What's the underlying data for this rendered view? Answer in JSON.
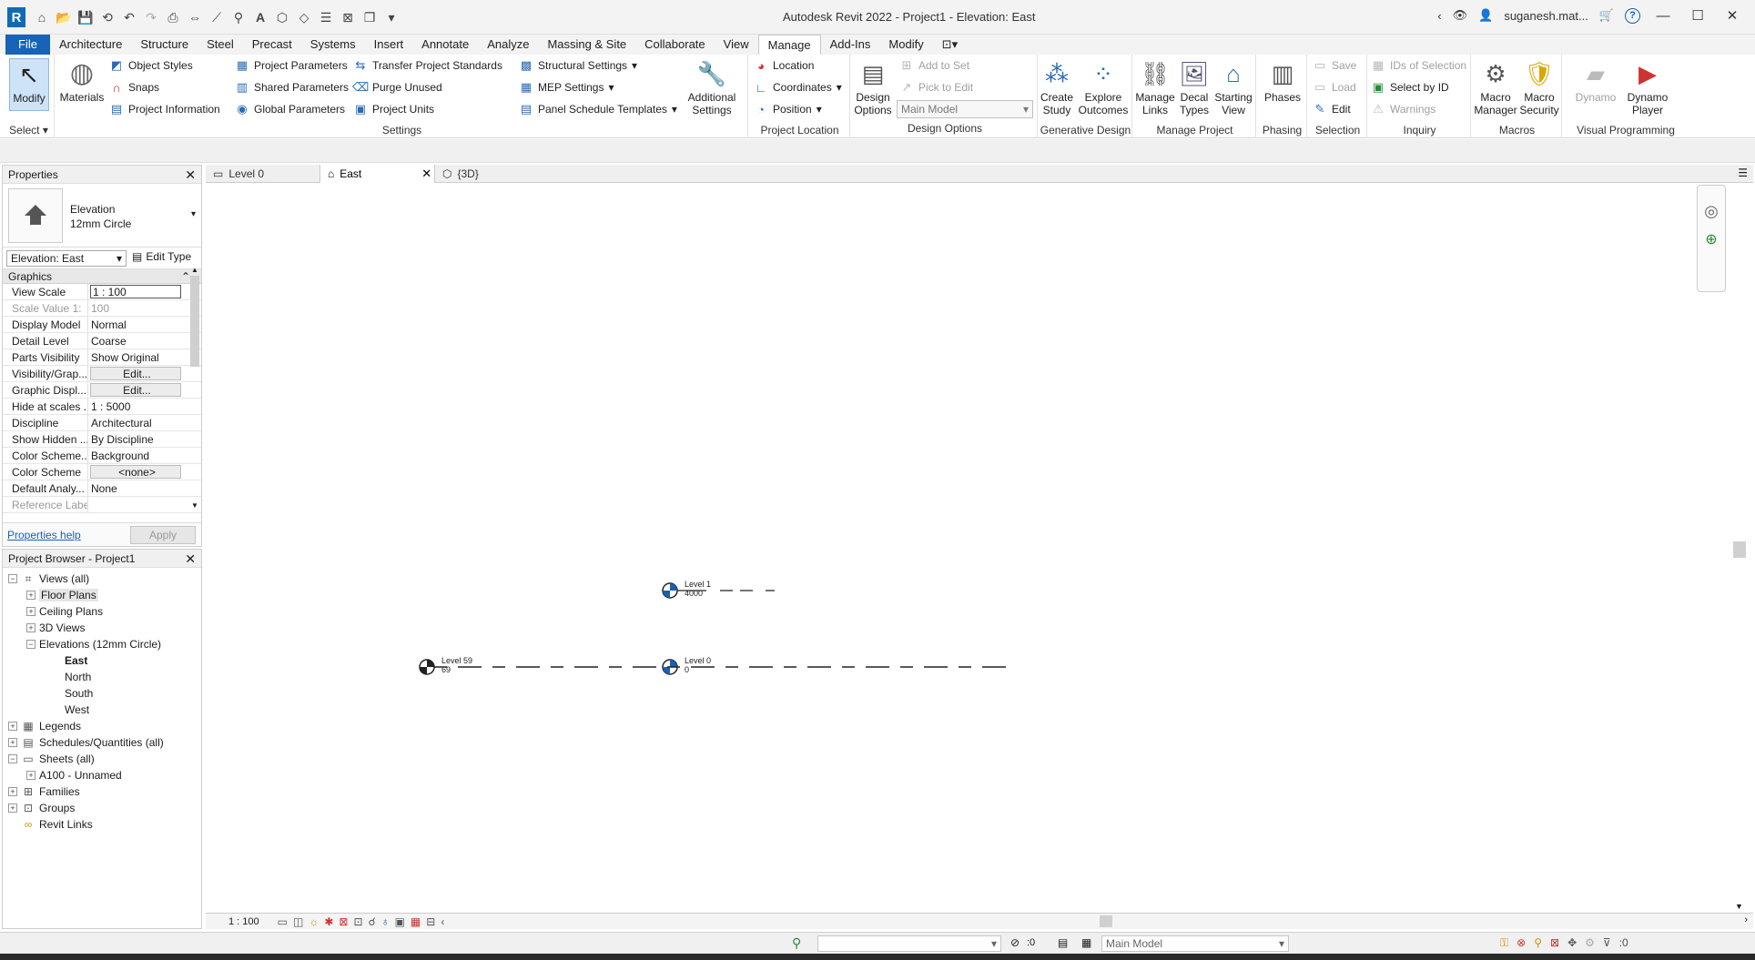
{
  "app": {
    "title": "Autodesk Revit 2022 - Project1 - Elevation: East",
    "user": "suganesh.mat...",
    "help": "?"
  },
  "menu": {
    "tabs": [
      "File",
      "Architecture",
      "Structure",
      "Steel",
      "Precast",
      "Systems",
      "Insert",
      "Annotate",
      "Analyze",
      "Massing & Site",
      "Collaborate",
      "View",
      "Manage",
      "Add-Ins",
      "Modify"
    ],
    "active": "Manage"
  },
  "ribbon": {
    "select": {
      "modify": "Modify",
      "title": "Select"
    },
    "settings": {
      "materials": "Materials",
      "object_styles": "Object  Styles",
      "snaps": "Snaps",
      "project_information": "Project  Information",
      "project_parameters": "Project  Parameters",
      "shared_parameters": "Shared  Parameters",
      "global_parameters": "Global  Parameters",
      "transfer_standards": "Transfer  Project Standards",
      "purge_unused": "Purge  Unused",
      "project_units": "Project  Units",
      "structural_settings": "Structural  Settings",
      "mep_settings": "MEP  Settings",
      "panel_schedule_templates": "Panel Schedule  Templates",
      "additional_settings_1": "Additional",
      "additional_settings_2": "Settings",
      "title": "Settings"
    },
    "project_location": {
      "location": "Location",
      "coordinates": "Coordinates",
      "position": "Position",
      "title": "Project Location"
    },
    "design_options": {
      "btn1": "Design",
      "btn2": "Options",
      "add_to_set": "Add to Set",
      "pick_to_edit": "Pick to Edit",
      "main_model": "Main Model",
      "title": "Design Options"
    },
    "generative_design": {
      "create_1": "Create",
      "create_2": "Study",
      "explore_1": "Explore",
      "explore_2": "Outcomes",
      "title": "Generative Design"
    },
    "manage_project": {
      "links_1": "Manage",
      "links_2": "Links",
      "decal_1": "Decal",
      "decal_2": "Types",
      "start_1": "Starting",
      "start_2": "View",
      "title": "Manage Project"
    },
    "phasing": {
      "phases": "Phases",
      "title": "Phasing"
    },
    "selection": {
      "save": "Save",
      "load": "Load",
      "edit": "Edit",
      "title": "Selection"
    },
    "inquiry": {
      "ids": "IDs of  Selection",
      "select_by_id": "Select  by ID",
      "warnings": "Warnings",
      "title": "Inquiry"
    },
    "macros": {
      "mm_1": "Macro",
      "mm_2": "Manager",
      "ms_1": "Macro",
      "ms_2": "Security",
      "title": "Macros"
    },
    "visual_programming": {
      "dynamo": "Dynamo",
      "player_1": "Dynamo",
      "player_2": "Player",
      "title": "Visual Programming"
    }
  },
  "properties": {
    "header": "Properties",
    "type_family": "Elevation",
    "type_name": "12mm Circle",
    "instance": "Elevation: East",
    "edit_type": "Edit Type",
    "group": "Graphics",
    "rows": [
      {
        "k": "View Scale",
        "v": "1 : 100"
      },
      {
        "k": "Scale Value    1:",
        "v": "100"
      },
      {
        "k": "Display Model",
        "v": "Normal"
      },
      {
        "k": "Detail Level",
        "v": "Coarse"
      },
      {
        "k": "Parts Visibility",
        "v": "Show Original"
      },
      {
        "k": "Visibility/Grap...",
        "v": "Edit..."
      },
      {
        "k": "Graphic Displ...",
        "v": "Edit..."
      },
      {
        "k": "Hide at scales ...",
        "v": "1 : 5000"
      },
      {
        "k": "Discipline",
        "v": "Architectural"
      },
      {
        "k": "Show Hidden ...",
        "v": "By Discipline"
      },
      {
        "k": "Color Scheme...",
        "v": "Background"
      },
      {
        "k": "Color Scheme",
        "v": "<none>"
      },
      {
        "k": "Default Analy...",
        "v": "None"
      },
      {
        "k": "Reference Label",
        "v": ""
      }
    ],
    "help": "Properties help",
    "apply": "Apply"
  },
  "browser": {
    "header": "Project Browser - Project1",
    "nodes": [
      {
        "label": "Views (all)",
        "level": 0,
        "exp": "−"
      },
      {
        "label": "Floor Plans",
        "level": 1,
        "exp": "+"
      },
      {
        "label": "Ceiling Plans",
        "level": 1,
        "exp": "+"
      },
      {
        "label": "3D Views",
        "level": 1,
        "exp": "+"
      },
      {
        "label": "Elevations (12mm Circle)",
        "level": 1,
        "exp": "−"
      },
      {
        "label": "East",
        "level": 2,
        "exp": ""
      },
      {
        "label": "North",
        "level": 2,
        "exp": ""
      },
      {
        "label": "South",
        "level": 2,
        "exp": ""
      },
      {
        "label": "West",
        "level": 2,
        "exp": ""
      },
      {
        "label": "Legends",
        "level": 0,
        "exp": "+"
      },
      {
        "label": "Schedules/Quantities (all)",
        "level": 0,
        "exp": "+"
      },
      {
        "label": "Sheets (all)",
        "level": 0,
        "exp": "−"
      },
      {
        "label": "A100 - Unnamed",
        "level": 1,
        "exp": "+"
      },
      {
        "label": "Families",
        "level": 0,
        "exp": "+"
      },
      {
        "label": "Groups",
        "level": 0,
        "exp": "+"
      },
      {
        "label": "Revit Links",
        "level": 0,
        "exp": ""
      }
    ]
  },
  "viewtabs": {
    "t1": "Level 0",
    "t2": "East",
    "t3": "{3D}"
  },
  "canvas": {
    "level1_name": "Level 1",
    "level1_elev": "4000",
    "level0_name": "Level 0",
    "level0_elev": "0",
    "level59_name": "Level 59",
    "level59_elev": "69"
  },
  "viewcontrol": {
    "scale": "1 : 100"
  },
  "status": {
    "count1": ":0",
    "model": "Main Model",
    "filter": ":0"
  }
}
